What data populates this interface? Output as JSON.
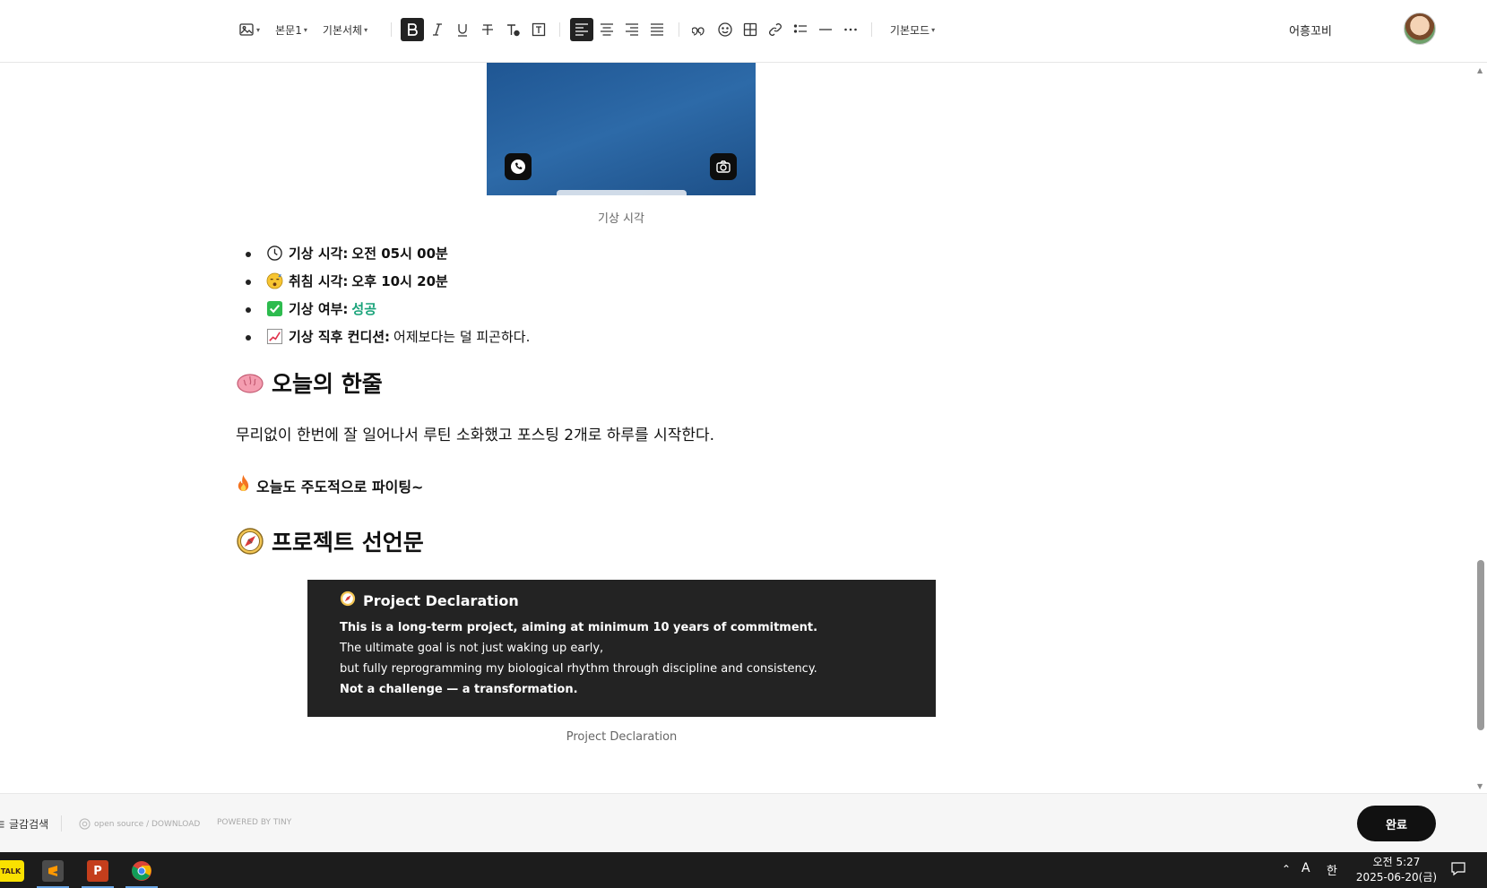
{
  "toolbar": {
    "paragraph_style": "본문1",
    "font_family": "기본서체",
    "mode": "기본모드",
    "user_name": "어흥꼬비",
    "accent": "#222222"
  },
  "image1": {
    "caption": "기상 시각"
  },
  "list": [
    {
      "icon": "clock-icon",
      "label": "기상 시각:",
      "value": "오전 05시 00분",
      "value_bold": true
    },
    {
      "icon": "sleepy-face-icon",
      "label": "취침 시각:",
      "value": "오후 10시 20분",
      "value_bold": true
    },
    {
      "icon": "check-mark-icon",
      "label": "기상 여부:",
      "value": "성공",
      "value_color": "#1aa37a"
    },
    {
      "icon": "chart-increasing-icon",
      "label": "기상 직후 컨디션:",
      "value": "어제보다는 덜 피곤하다."
    }
  ],
  "section1": {
    "heading": "오늘의 한줄",
    "paragraph": "무리없이 한번에 잘 일어나서 루틴 소화했고 포스팅 2개로 하루를 시작한다.",
    "bold_line": "오늘도 주도적으로 파이팅~"
  },
  "section2": {
    "heading": "프로젝트 선언문"
  },
  "declaration": {
    "title": "Project Declaration",
    "line1": "This is a long-term project, aiming at minimum 10 years of commitment.",
    "line2": "The ultimate goal is not just waking up early,",
    "line3": "but fully reprogramming my biological rhythm through discipline and consistency.",
    "line4": "Not a challenge — a transformation.",
    "caption": "Project Declaration"
  },
  "footer": {
    "search_label": "글감검색",
    "open_source": "open source / DOWNLOAD",
    "powered": "POWERED BY TINY",
    "done_label": "완료"
  },
  "taskbar": {
    "apps": [
      "kakaotalk-icon",
      "sublime-text-icon",
      "powerpoint-icon",
      "chrome-icon"
    ],
    "kakao_label": "TALK",
    "ppt_label": "P",
    "ime_label": "A",
    "lang_label": "한",
    "time": "오전 5:27",
    "date": "2025-06-20(금)"
  }
}
